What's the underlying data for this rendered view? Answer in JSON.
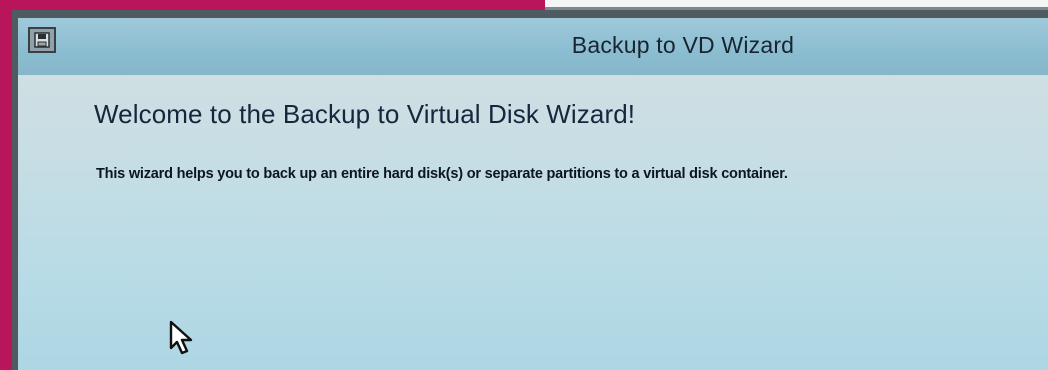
{
  "window": {
    "title": "Backup to VD Wizard",
    "icon": "backup-app-icon"
  },
  "wizard": {
    "heading": "Welcome to the Backup to Virtual Disk Wizard!",
    "description": "This wizard helps you to back up an entire hard disk(s) or separate partitions to a virtual disk container."
  },
  "pointer": {
    "icon": "mouse-cursor-icon"
  },
  "colors": {
    "desktop": "#b8155a",
    "titlebar": "#8bbdd1",
    "content": "#c4dde4",
    "text": "#16263c"
  }
}
